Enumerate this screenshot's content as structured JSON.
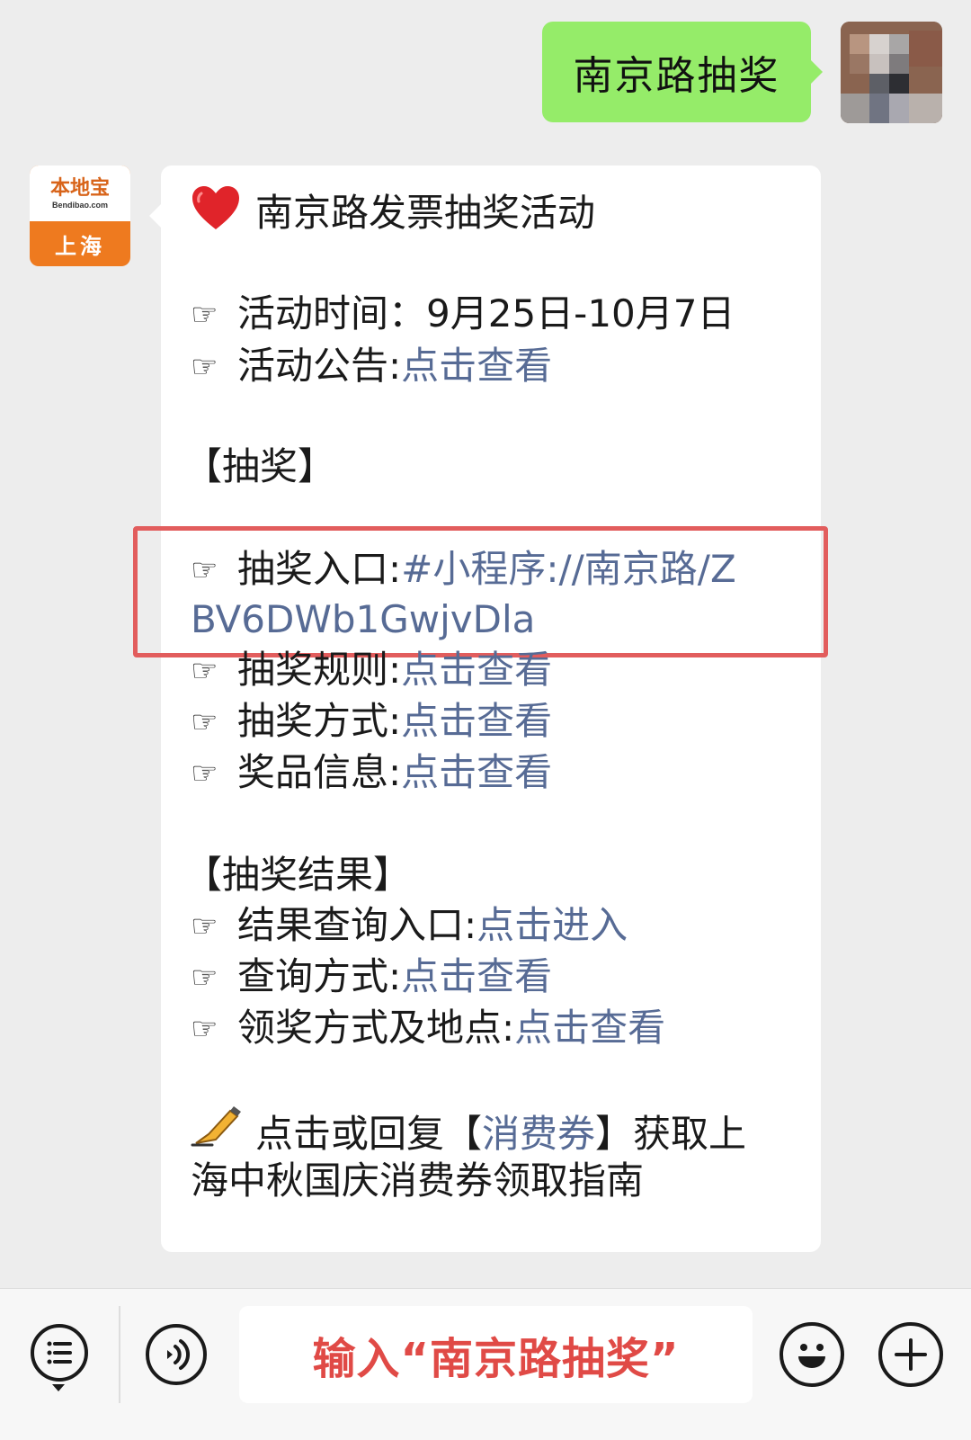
{
  "outgoing_message": {
    "text": "南京路抽奖"
  },
  "incoming_message": {
    "title": "南京路发票抽奖活动",
    "hand_glyph": "☞",
    "activity_time_label": "活动时间：",
    "activity_time_value": "9月25日-10月7日",
    "announcement_label": "活动公告:",
    "announcement_link": "点击查看",
    "section_lottery": "【抽奖】",
    "entry_label": "抽奖入口:",
    "entry_link_line1": "#小程序://南京路/Z",
    "entry_link_line2": "BV6DWb1GwjvDla",
    "rules_label": "抽奖规则:",
    "rules_link": "点击查看",
    "method_label": "抽奖方式:",
    "method_link": "点击查看",
    "prize_label": "奖品信息:",
    "prize_link": "点击查看",
    "section_results": "【抽奖结果】",
    "result_entry_label": "结果查询入口:",
    "result_entry_link": "点击进入",
    "query_method_label": "查询方式:",
    "query_method_link": "点击查看",
    "claim_label": "领奖方式及地点:",
    "claim_link": "点击查看",
    "footer_prefix": "点击或回复【",
    "footer_keyword": "消费券",
    "footer_suffix_line1": "】获取上",
    "footer_line2": "海中秋国庆消费券领取指南"
  },
  "bot_avatar": {
    "name": "本地宝",
    "domain": "Bendibao.com",
    "city": "上海",
    "bg_color": "#ee7a1f"
  },
  "input_bar": {
    "placeholder": "输入“南京路抽奖”",
    "placeholder_color": "#e04a46",
    "left_icon": "menu-list-icon",
    "voice_icon": "voice-icon",
    "emoji_icon": "emoji-icon",
    "plus_icon": "plus-icon"
  },
  "colors": {
    "background": "#ededed",
    "outgoing_bubble": "#95ec69",
    "incoming_bubble": "#ffffff",
    "link": "#576b95",
    "highlight_border": "#e25d5d"
  }
}
